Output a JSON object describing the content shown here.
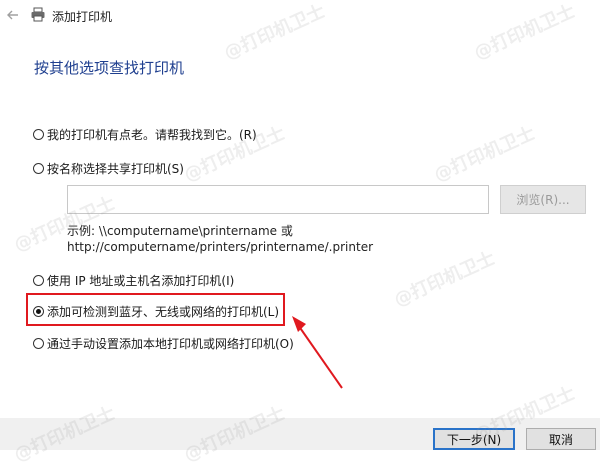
{
  "window": {
    "title": "添加打印机"
  },
  "heading": "按其他选项查找打印机",
  "options": [
    {
      "label": "我的打印机有点老。请帮我找到它。(R)",
      "checked": false
    },
    {
      "label": "按名称选择共享打印机(S)",
      "checked": false
    },
    {
      "label": "使用 IP 地址或主机名添加打印机(I)",
      "checked": false
    },
    {
      "label": "添加可检测到蓝牙、无线或网络的打印机(L)",
      "checked": true
    },
    {
      "label": "通过手动设置添加本地打印机或网络打印机(O)",
      "checked": false
    }
  ],
  "shared_printer": {
    "input_value": "",
    "browse_label": "浏览(R)...",
    "example_line1": "示例: \\\\computername\\printername 或",
    "example_line2": "http://computername/printers/printername/.printer"
  },
  "footer": {
    "next_label": "下一步(N)",
    "cancel_label": "取消"
  },
  "watermark": "@打印机卫士",
  "icons": {
    "back": "back-arrow-icon",
    "printer": "printer-icon"
  },
  "colors": {
    "heading": "#1f3f8f",
    "highlight": "#e0191f",
    "focus": "#2a73c9"
  }
}
